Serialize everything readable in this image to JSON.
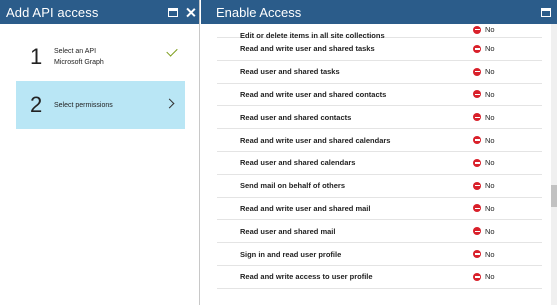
{
  "left_blade": {
    "title": "Add API access",
    "steps": [
      {
        "number": "1",
        "line1": "Select an API",
        "line2": "Microsoft Graph",
        "completed": true
      },
      {
        "number": "2",
        "line1": "Select permissions",
        "line2": "",
        "completed": false
      }
    ]
  },
  "right_blade": {
    "title": "Enable Access",
    "permissions": [
      {
        "label": "Edit or delete items in all site collections",
        "value": "No"
      },
      {
        "label": "Read and write user and shared tasks",
        "value": "No"
      },
      {
        "label": "Read user and shared tasks",
        "value": "No"
      },
      {
        "label": "Read and write user and shared contacts",
        "value": "No"
      },
      {
        "label": "Read user and shared contacts",
        "value": "No"
      },
      {
        "label": "Read and write user and shared calendars",
        "value": "No"
      },
      {
        "label": "Read user and shared calendars",
        "value": "No"
      },
      {
        "label": "Send mail on behalf of others",
        "value": "No"
      },
      {
        "label": "Read and write user and shared mail",
        "value": "No"
      },
      {
        "label": "Read user and shared mail",
        "value": "No"
      },
      {
        "label": "Sign in and read user profile",
        "value": "No"
      },
      {
        "label": "Read and write access to user profile",
        "value": "No"
      }
    ],
    "scroll_position": 0.62
  },
  "colors": {
    "header": "#2b5c8a",
    "active_step": "#b9e6f5",
    "check": "#7a9b16",
    "no_icon": "#d9202a"
  }
}
